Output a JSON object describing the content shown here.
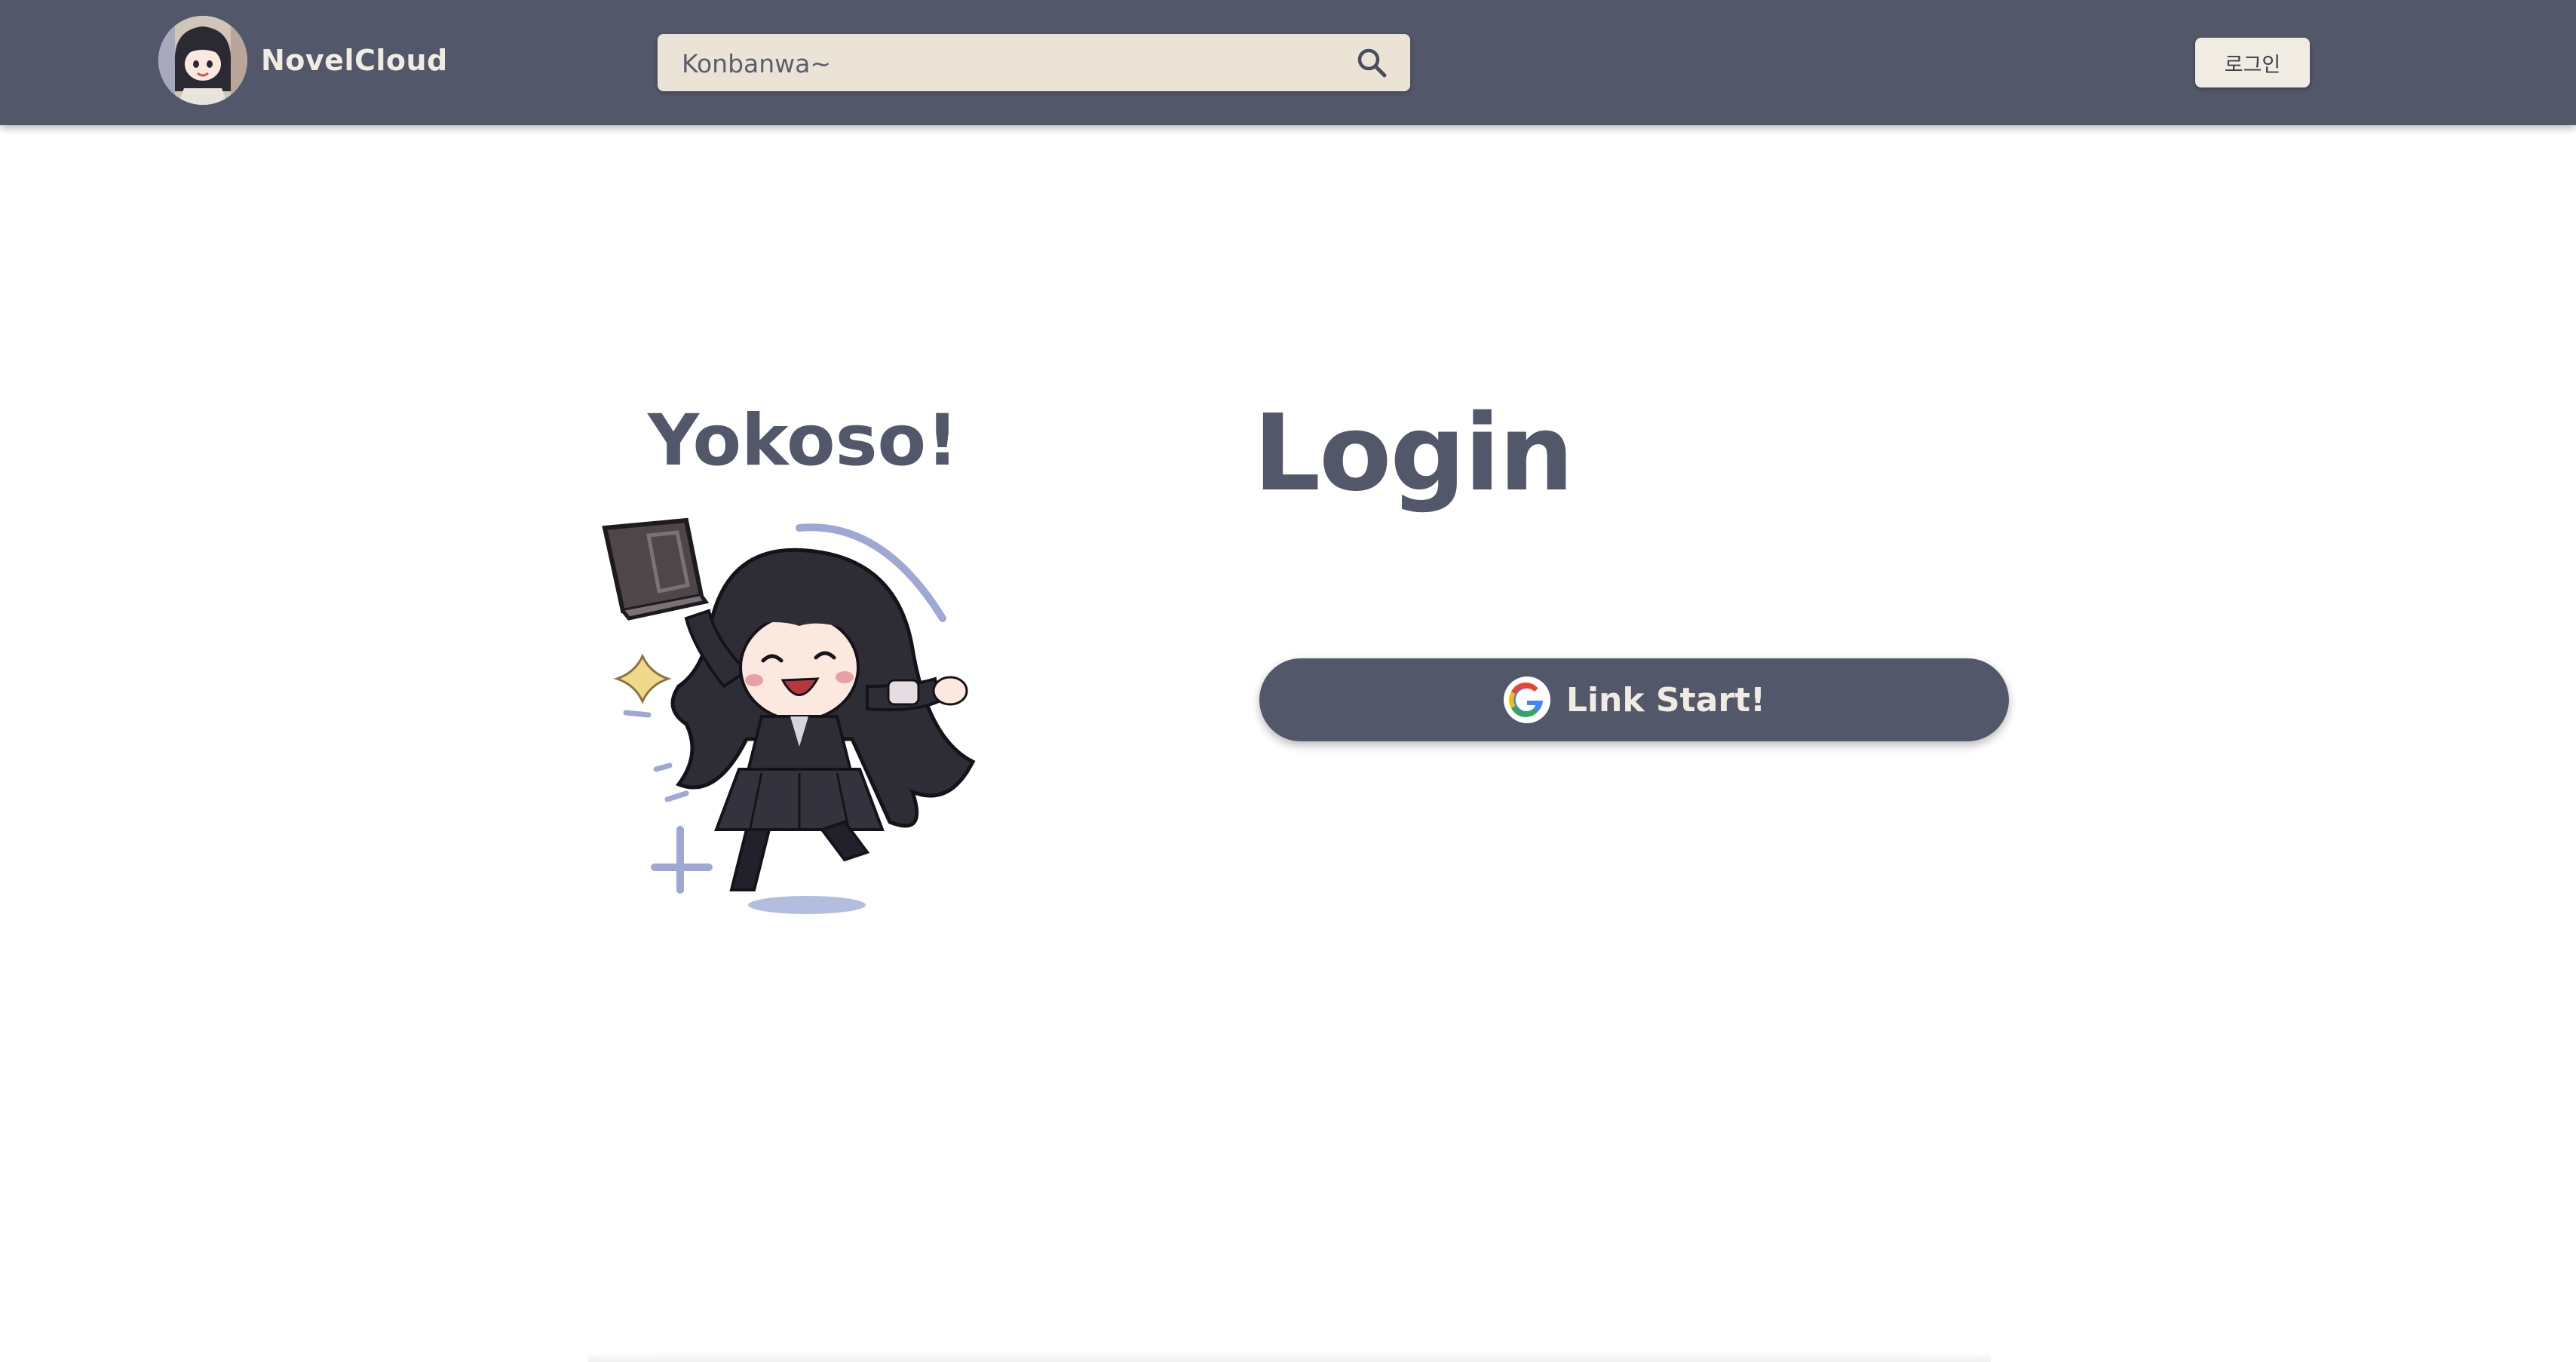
{
  "header": {
    "brand_name": "NovelCloud",
    "search": {
      "placeholder": "Konbanwa~",
      "icon": "search-icon"
    },
    "login_button_label": "로그인"
  },
  "main": {
    "welcome_text": "Yokoso!",
    "mascot": "anime-girl-with-book-illustration",
    "title": "Login",
    "link_button": {
      "label": "Link Start!",
      "icon": "google-icon"
    }
  },
  "colors": {
    "header_bg": "#525769",
    "search_bg": "#ebe3d6",
    "button_light": "#f1ece2",
    "accent_text": "#525769",
    "page_bg": "#ffffff"
  }
}
